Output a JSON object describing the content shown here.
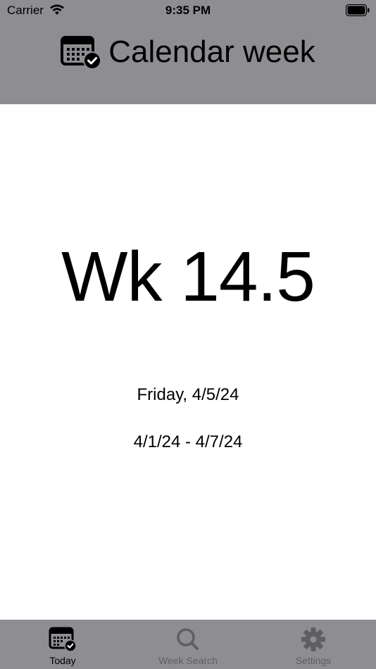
{
  "status_bar": {
    "carrier": "Carrier",
    "time": "9:35 PM"
  },
  "header": {
    "title": "Calendar week",
    "icon": "calendar-check-icon"
  },
  "main": {
    "week_number": "Wk 14.5",
    "date": "Friday, 4/5/24",
    "range": "4/1/24 - 4/7/24"
  },
  "tabs": [
    {
      "label": "Today",
      "icon": "calendar-check-icon",
      "active": true
    },
    {
      "label": "Week Search",
      "icon": "magnifier-icon",
      "active": false
    },
    {
      "label": "Settings",
      "icon": "gear-icon",
      "active": false
    }
  ],
  "colors": {
    "header_bg": "#8e8e92",
    "tab_bar_bg": "#8e8e92",
    "inactive": "#5f5f63"
  }
}
